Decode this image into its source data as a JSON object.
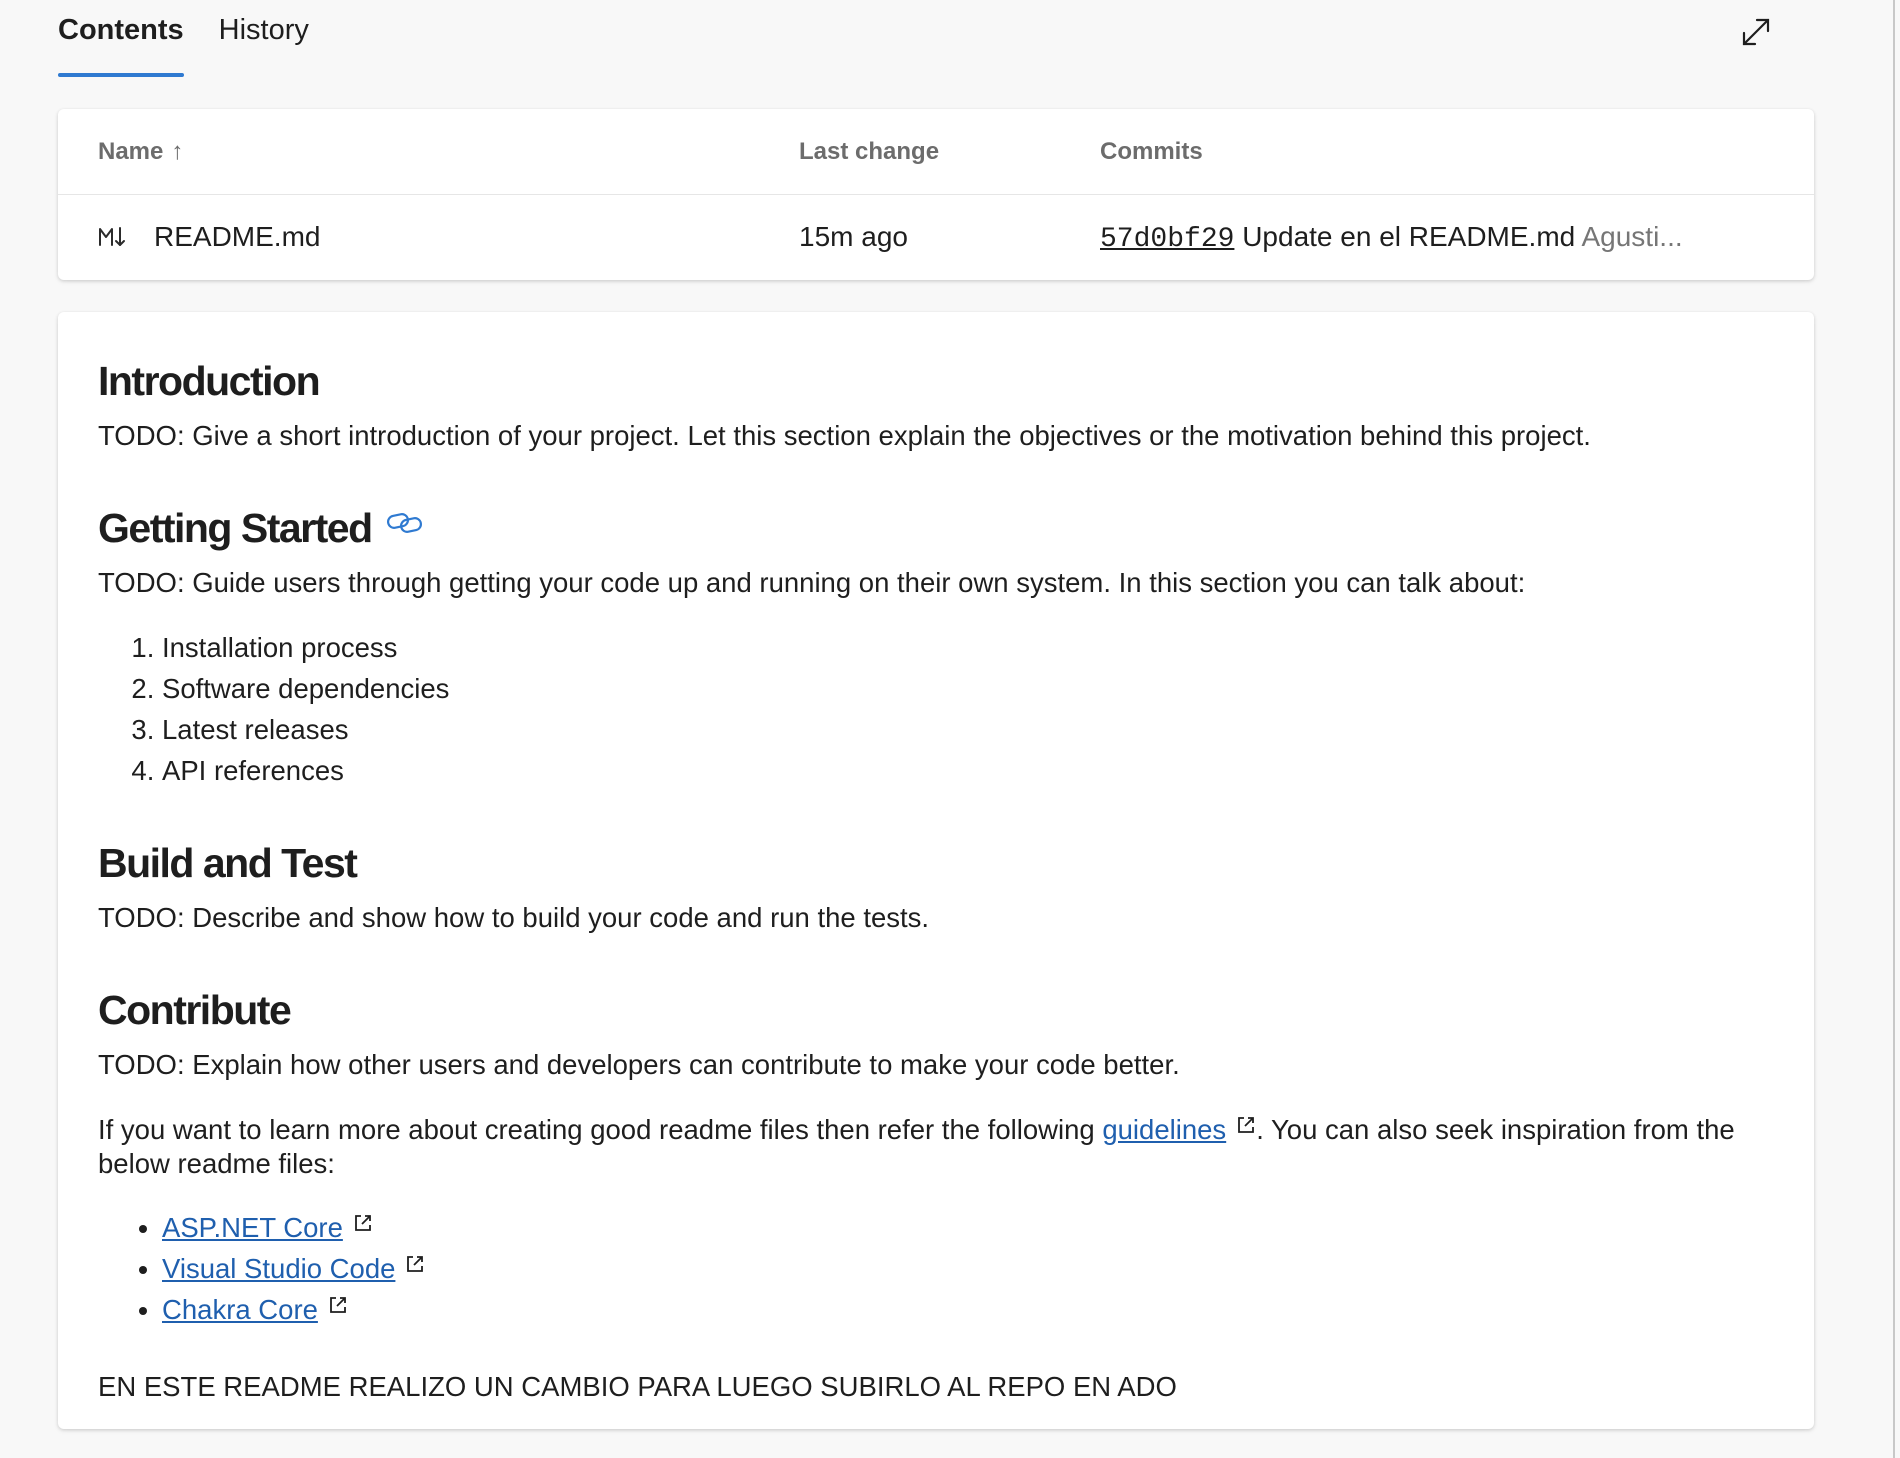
{
  "tabs": [
    {
      "label": "Contents",
      "active": true
    },
    {
      "label": "History",
      "active": false
    }
  ],
  "toolbar": {
    "expand_icon": "expand-icon"
  },
  "files": {
    "columns": {
      "name": "Name",
      "last_change": "Last change",
      "commits": "Commits"
    },
    "sort": {
      "column": "Name",
      "direction": "ascending",
      "icon": "arrow-up-icon"
    },
    "rows": [
      {
        "icon": "markdown-icon",
        "name": "README.md",
        "last_change": "15m ago",
        "commit_hash": "57d0bf29",
        "commit_message": "Update en el README.md",
        "commit_author": "Agusti..."
      }
    ]
  },
  "readme": {
    "intro": {
      "heading": "Introduction",
      "text": "TODO: Give a short introduction of your project. Let this section explain the objectives or the motivation behind this project."
    },
    "getting_started": {
      "heading": "Getting Started",
      "anchor_icon": "link-icon",
      "text": "TODO: Guide users through getting your code up and running on their own system. In this section you can talk about:",
      "items": [
        "Installation process",
        "Software dependencies",
        "Latest releases",
        "API references"
      ]
    },
    "build_test": {
      "heading": "Build and Test",
      "text": "TODO: Describe and show how to build your code and run the tests."
    },
    "contribute": {
      "heading": "Contribute",
      "text": "TODO: Explain how other users and developers can contribute to make your code better.",
      "more_before": "If you want to learn more about creating good readme files then refer the following ",
      "more_link": "guidelines",
      "more_after": ". You can also seek inspiration from the below readme files:",
      "links": [
        "ASP.NET Core",
        "Visual Studio Code",
        "Chakra Core"
      ],
      "footer": "EN ESTE README REALIZO UN CAMBIO PARA LUEGO SUBIRLO AL REPO EN ADO"
    }
  },
  "colors": {
    "accent": "#2f7ad1",
    "link": "#1f5fae",
    "background": "#f8f8f8",
    "card": "#ffffff",
    "muted_text": "#6c6c6c"
  }
}
